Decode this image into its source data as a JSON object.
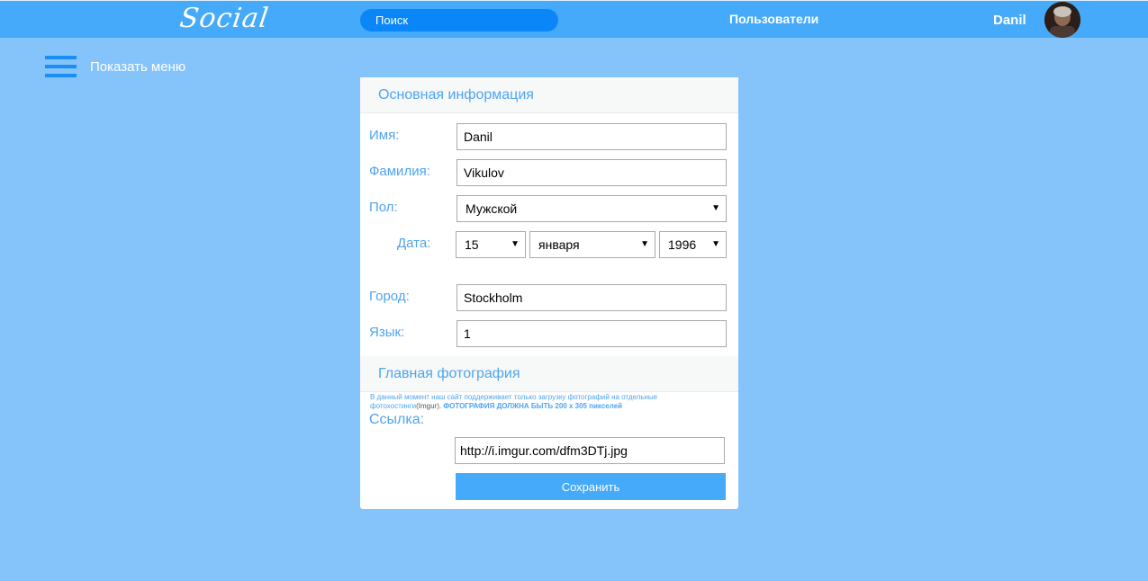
{
  "header": {
    "logo_text": "Social",
    "search_placeholder": "Поиск",
    "users_link": "Пользователи",
    "username": "Danil"
  },
  "menu": {
    "label": "Показать меню"
  },
  "basic_info": {
    "title": "Основная информация",
    "first_name_label": "Имя:",
    "first_name_value": "Danil",
    "last_name_label": "Фамилия:",
    "last_name_value": "Vikulov",
    "gender_label": "Пол:",
    "gender_value": "Мужской",
    "date_label": "Дата:",
    "day_value": "15",
    "month_value": "января",
    "year_value": "1996",
    "city_label": "Город:",
    "city_value": "Stockholm",
    "language_label": "Язык:",
    "language_value": "1"
  },
  "photo": {
    "title": "Главная фотография",
    "note_text": "В данный момент наш сайт поддерживает только загрузку фотографий на отдельные фотохостинги",
    "note_host": "(Imgur).",
    "note_bold": "ФОТОГРАФИЯ ДОЛЖНА БЫТЬ 200 x 305 пикселей",
    "link_label": "Ссылка:",
    "link_value": "http://i.imgur.com/dfm3DTj.jpg",
    "save_label": "Сохранить"
  },
  "colors": {
    "page_bg": "#84c4fb",
    "topbar": "#45aaf9",
    "search_bg": "#0a86f8",
    "label_blue": "#4fa4ef",
    "button": "#45aaf9"
  },
  "icons": {
    "menu": "hamburger-icon",
    "caret": "▼"
  }
}
